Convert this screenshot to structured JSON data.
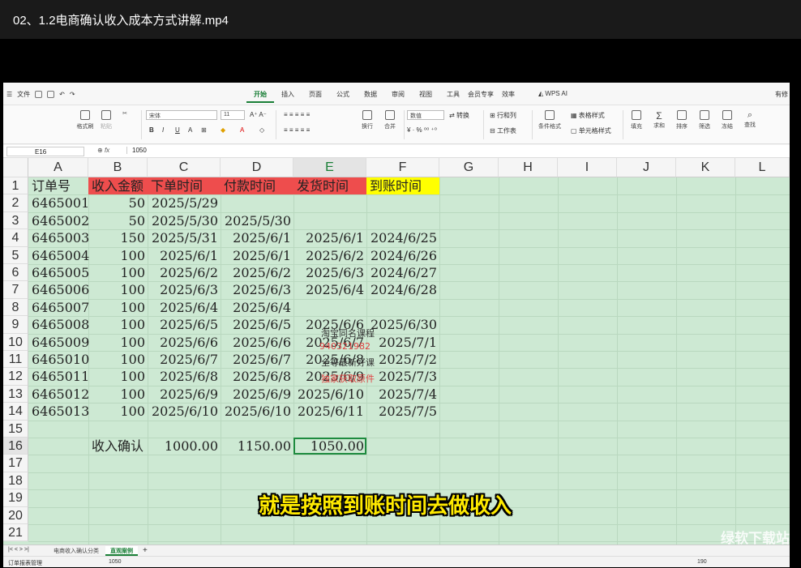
{
  "video": {
    "title": "02、1.2电商确认收入成本方式讲解.mp4"
  },
  "menubar": {
    "file_label": "文件",
    "tabs": [
      "开始",
      "插入",
      "页面",
      "公式",
      "数据",
      "审阅",
      "视图",
      "工具",
      "会员专享",
      "效率"
    ],
    "active_tab": "开始",
    "wps_ai": "WPS AI",
    "right_label": "有修"
  },
  "ribbon": {
    "format_painter": "格式刷",
    "paste": "粘贴",
    "font_name": "宋体",
    "font_size": "11",
    "wrap": "换行",
    "merge": "合并",
    "number_format": "数值",
    "convert": "转换",
    "rows_cols": "行和列",
    "worksheet": "工作表",
    "cond_format": "条件格式",
    "table_style": "表格样式",
    "cell_style": "单元格样式",
    "fill": "填充",
    "sum": "求和",
    "sort": "排序",
    "filter": "筛选",
    "freeze": "冻结",
    "find": "查找"
  },
  "formula_bar": {
    "cell_ref": "E16",
    "fx": "fx",
    "value": "1050"
  },
  "columns": [
    "A",
    "B",
    "C",
    "D",
    "E",
    "F",
    "G",
    "H",
    "I",
    "J",
    "K",
    "L"
  ],
  "rows": [
    "1",
    "2",
    "3",
    "4",
    "5",
    "6",
    "7",
    "8",
    "9",
    "10",
    "11",
    "12",
    "13",
    "14",
    "15",
    "16",
    "17",
    "18",
    "19",
    "20",
    "21"
  ],
  "headers": [
    "订单号",
    "收入金额",
    "下单时间",
    "付款时间",
    "发货时间",
    "到账时间"
  ],
  "table": [
    [
      "6465001",
      "50",
      "2025/5/29",
      "",
      "",
      ""
    ],
    [
      "6465002",
      "50",
      "2025/5/30",
      "2025/5/30",
      "",
      ""
    ],
    [
      "6465003",
      "150",
      "2025/5/31",
      "2025/6/1",
      "2025/6/1",
      "2024/6/25"
    ],
    [
      "6465004",
      "100",
      "2025/6/1",
      "2025/6/1",
      "2025/6/2",
      "2024/6/26"
    ],
    [
      "6465005",
      "100",
      "2025/6/2",
      "2025/6/2",
      "2025/6/3",
      "2024/6/27"
    ],
    [
      "6465006",
      "100",
      "2025/6/3",
      "2025/6/3",
      "2025/6/4",
      "2024/6/28"
    ],
    [
      "6465007",
      "100",
      "2025/6/4",
      "2025/6/4",
      "",
      ""
    ],
    [
      "6465008",
      "100",
      "2025/6/5",
      "2025/6/5",
      "2025/6/6",
      "2025/6/30"
    ],
    [
      "6465009",
      "100",
      "2025/6/6",
      "2025/6/6",
      "2025/6/7",
      "2025/7/1"
    ],
    [
      "6465010",
      "100",
      "2025/6/7",
      "2025/6/7",
      "2025/6/8",
      "2025/7/2"
    ],
    [
      "6465011",
      "100",
      "2025/6/8",
      "2025/6/8",
      "2025/6/9",
      "2025/7/3"
    ],
    [
      "6465012",
      "100",
      "2025/6/9",
      "2025/6/9",
      "2025/6/10",
      "2025/7/4"
    ],
    [
      "6465013",
      "100",
      "2025/6/10",
      "2025/6/10",
      "2025/6/11",
      "2025/7/5"
    ]
  ],
  "summary": {
    "label": "收入确认",
    "c": "1000.00",
    "d": "1150.00",
    "e": "1050.00"
  },
  "watermark": {
    "line1": "淘宝同名课程",
    "line2": "940321982",
    "line3": "全等最新好课",
    "line4": "独家获取原件"
  },
  "subtitle": "就是按照到账时间去做收入",
  "sheets": [
    "电商收入确认分类",
    "直观案例"
  ],
  "active_sheet": "直观案例",
  "status": {
    "left": "订单报表管理",
    "value": "1050",
    "zoom": "190"
  },
  "logo_watermark": "绿软下载站",
  "colors": {
    "red_header": "#ee4d4d",
    "yellow_header": "#ffff00",
    "sheet_bg": "#cde9d3",
    "accent": "#1a7f37"
  }
}
